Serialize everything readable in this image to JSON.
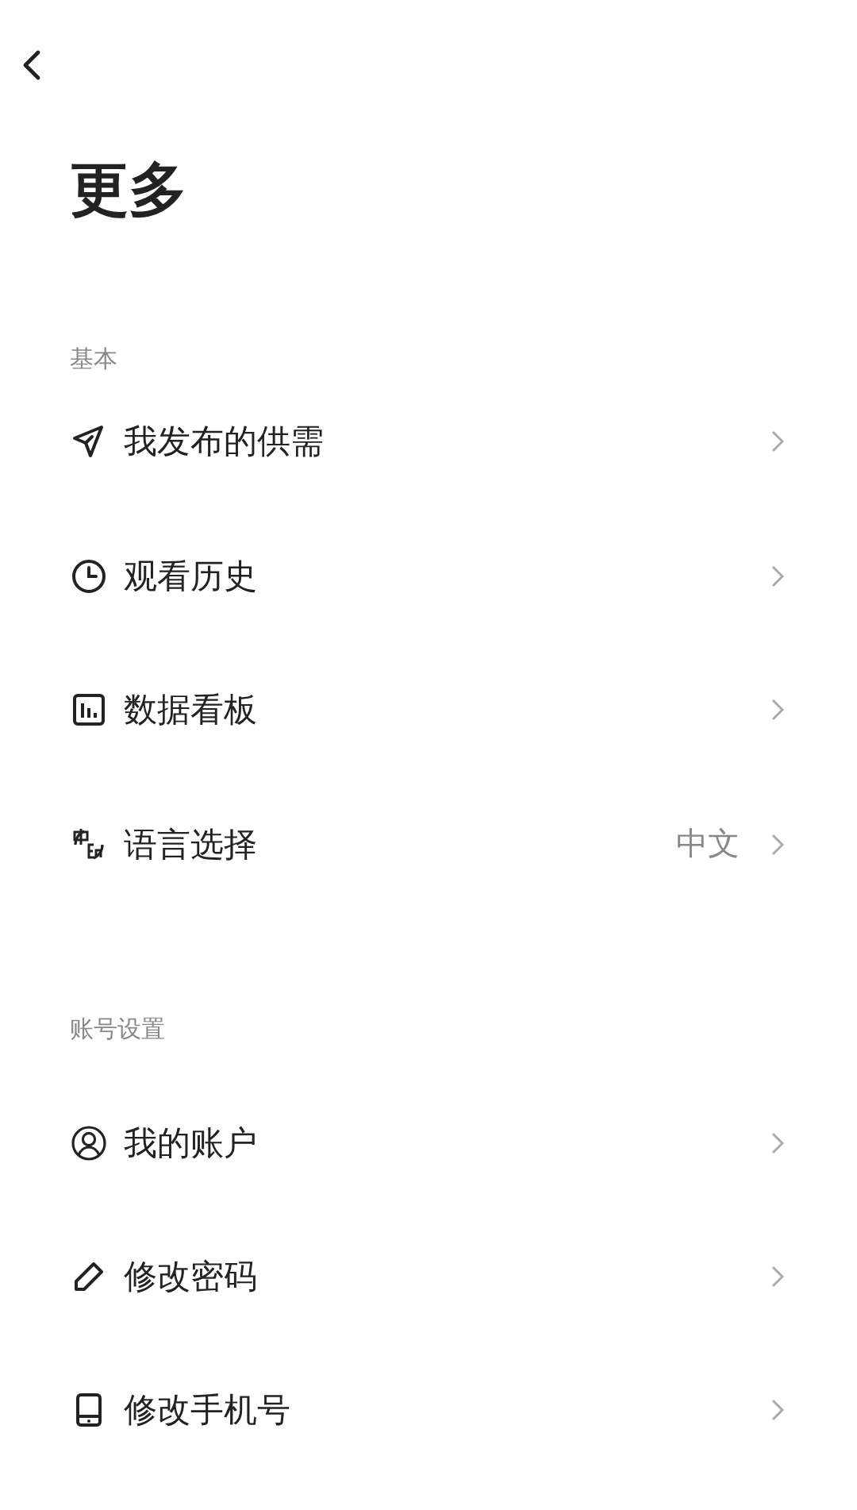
{
  "title": "更多",
  "sections": [
    {
      "label": "基本",
      "items": [
        {
          "label": "我发布的供需"
        },
        {
          "label": "观看历史"
        },
        {
          "label": "数据看板"
        },
        {
          "label": "语言选择",
          "value": "中文"
        }
      ]
    },
    {
      "label": "账号设置",
      "items": [
        {
          "label": "我的账户"
        },
        {
          "label": "修改密码"
        },
        {
          "label": "修改手机号"
        }
      ]
    }
  ]
}
